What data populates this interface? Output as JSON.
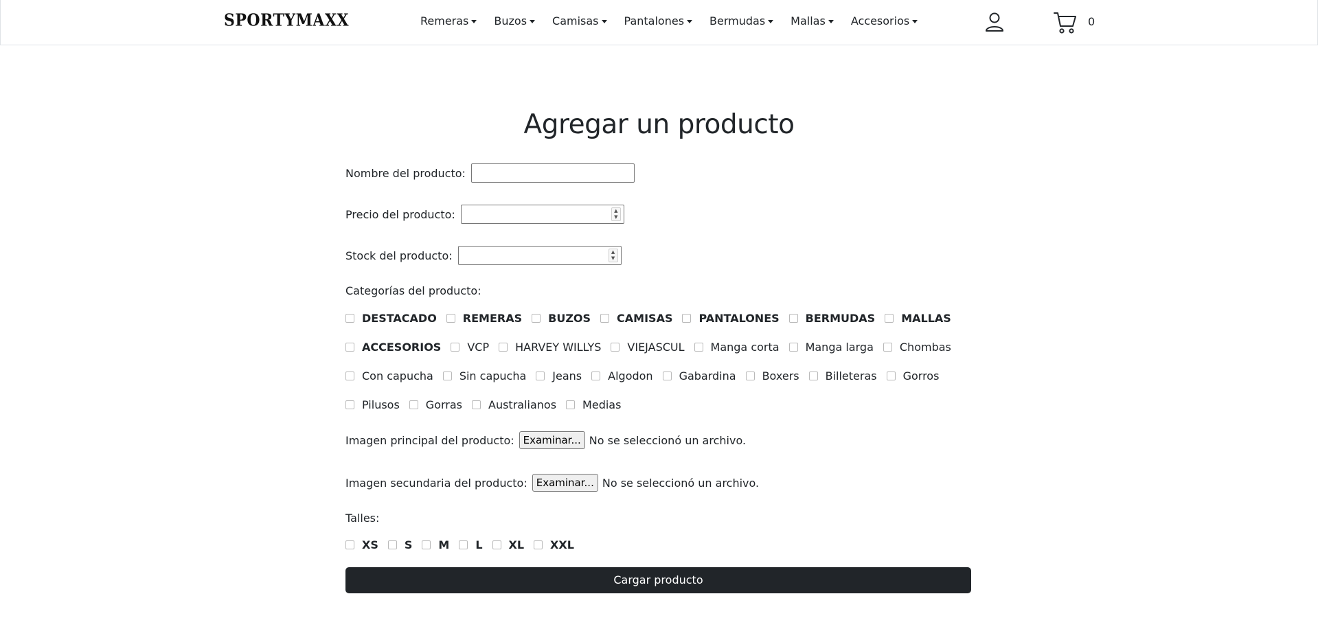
{
  "brand": {
    "logo_text": "SPORTYMAXX"
  },
  "nav": {
    "items": [
      {
        "label": "Remeras"
      },
      {
        "label": "Buzos"
      },
      {
        "label": "Camisas"
      },
      {
        "label": "Pantalones"
      },
      {
        "label": "Bermudas"
      },
      {
        "label": "Mallas"
      },
      {
        "label": "Accesorios"
      }
    ],
    "user_icon": "user-icon",
    "cart_icon": "cart-icon",
    "cart_count": "0"
  },
  "form": {
    "title": "Agregar un producto",
    "name_label": "Nombre del producto:",
    "name_value": "",
    "price_label": "Precio del producto:",
    "price_value": "",
    "stock_label": "Stock del producto:",
    "stock_value": "",
    "categories_label": "Categorías del producto:",
    "categories": [
      {
        "label": "DESTACADO",
        "bold": true,
        "checked": false
      },
      {
        "label": "REMERAS",
        "bold": true,
        "checked": false
      },
      {
        "label": "BUZOS",
        "bold": true,
        "checked": false
      },
      {
        "label": "CAMISAS",
        "bold": true,
        "checked": false
      },
      {
        "label": "PANTALONES",
        "bold": true,
        "checked": false
      },
      {
        "label": "BERMUDAS",
        "bold": true,
        "checked": false
      },
      {
        "label": "MALLAS",
        "bold": true,
        "checked": false
      },
      {
        "label": "ACCESORIOS",
        "bold": true,
        "checked": false
      },
      {
        "label": "VCP",
        "bold": false,
        "checked": false
      },
      {
        "label": "HARVEY WILLYS",
        "bold": false,
        "checked": false
      },
      {
        "label": "VIEJASCUL",
        "bold": false,
        "checked": false
      },
      {
        "label": "Manga corta",
        "bold": false,
        "checked": false
      },
      {
        "label": "Manga larga",
        "bold": false,
        "checked": false
      },
      {
        "label": "Chombas",
        "bold": false,
        "checked": false
      },
      {
        "label": "Con capucha",
        "bold": false,
        "checked": false
      },
      {
        "label": "Sin capucha",
        "bold": false,
        "checked": false
      },
      {
        "label": "Jeans",
        "bold": false,
        "checked": false
      },
      {
        "label": "Algodon",
        "bold": false,
        "checked": false
      },
      {
        "label": "Gabardina",
        "bold": false,
        "checked": false
      },
      {
        "label": "Boxers",
        "bold": false,
        "checked": false
      },
      {
        "label": "Billeteras",
        "bold": false,
        "checked": false
      },
      {
        "label": "Gorros",
        "bold": false,
        "checked": false
      },
      {
        "label": "Pilusos",
        "bold": false,
        "checked": false
      },
      {
        "label": "Gorras",
        "bold": false,
        "checked": false
      },
      {
        "label": "Australianos",
        "bold": false,
        "checked": false
      },
      {
        "label": "Medias",
        "bold": false,
        "checked": false
      }
    ],
    "main_image_label": "Imagen principal del producto:",
    "main_image_button": "Examinar...",
    "main_image_status": "No se seleccionó un archivo.",
    "secondary_image_label": "Imagen secundaria del producto:",
    "secondary_image_button": "Examinar...",
    "secondary_image_status": "No se seleccionó un archivo.",
    "sizes_label": "Talles:",
    "sizes": [
      {
        "label": "XS",
        "checked": false
      },
      {
        "label": "S",
        "checked": false
      },
      {
        "label": "M",
        "checked": false
      },
      {
        "label": "L",
        "checked": false
      },
      {
        "label": "XL",
        "checked": false
      },
      {
        "label": "XXL",
        "checked": false
      }
    ],
    "submit_label": "Cargar producto"
  },
  "colors": {
    "primary_button": "#212529",
    "text": "#212529",
    "border": "#dee2e6"
  }
}
